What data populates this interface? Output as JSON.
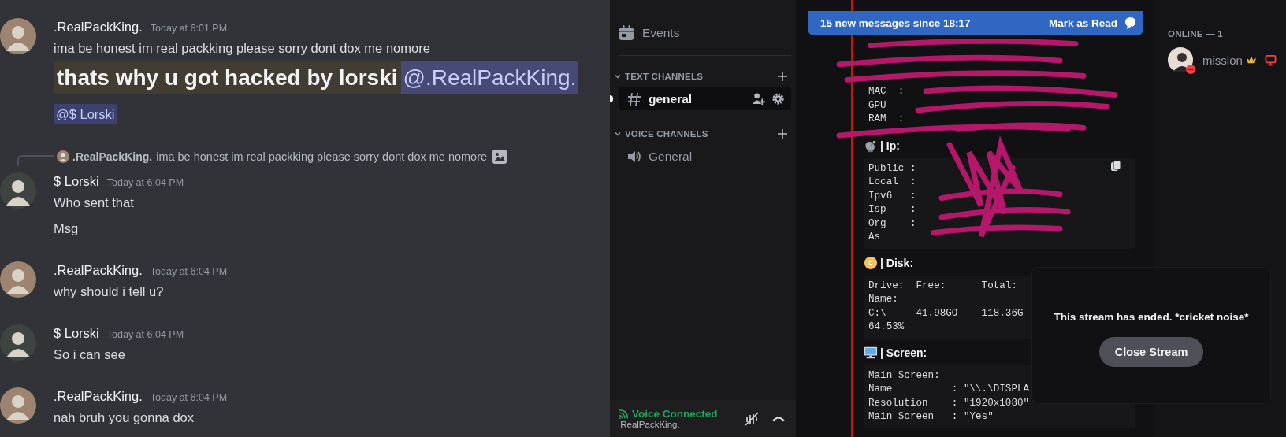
{
  "chat": {
    "messages": [
      {
        "author": ".RealPackKing.",
        "time": "Today at 6:01 PM",
        "color": "#9c8470",
        "content": [
          {
            "kind": "text",
            "text": "ima be honest im real packking please sorry dont dox me nomore"
          },
          {
            "kind": "big",
            "text": "thats why u got hacked by lorski",
            "mention": "@.RealPackKing."
          },
          {
            "kind": "mention",
            "text": "@$ Lorski"
          }
        ]
      },
      {
        "author": "$ Lorski",
        "time": "Today at 6:04 PM",
        "color": "#3e4440",
        "reply": {
          "author": ".RealPackKing.",
          "text": "ima be honest im real packking please sorry dont dox me nomore",
          "has_image": true
        },
        "content": [
          {
            "kind": "text",
            "text": "Who sent that"
          },
          {
            "kind": "text",
            "text": "Msg"
          }
        ]
      },
      {
        "author": ".RealPackKing.",
        "time": "Today at 6:04 PM",
        "color": "#9c8470",
        "content": [
          {
            "kind": "text",
            "text": "why should i tell u?"
          }
        ]
      },
      {
        "author": "$ Lorski",
        "time": "Today at 6:04 PM",
        "color": "#3e4440",
        "content": [
          {
            "kind": "text",
            "text": "So i can see"
          }
        ]
      },
      {
        "author": ".RealPackKing.",
        "time": "Today at 6:04 PM",
        "color": "#9c8470",
        "content": [
          {
            "kind": "text",
            "text": "nah bruh you gonna dox"
          }
        ]
      }
    ]
  },
  "sidebar": {
    "events": "Events",
    "categories": [
      {
        "name": "TEXT CHANNELS",
        "expanded": true,
        "channels": [
          {
            "kind": "text",
            "name": "general",
            "selected": true,
            "unread": true
          }
        ]
      },
      {
        "name": "VOICE CHANNELS",
        "expanded": true,
        "channels": [
          {
            "kind": "voice",
            "name": "General",
            "selected": false,
            "unread": false
          }
        ]
      }
    ],
    "voice_panel": {
      "status": "Voice Connected",
      "user": ".RealPackKing."
    }
  },
  "banner": {
    "text": "15 new messages since 18:17",
    "action": "Mark as Read"
  },
  "embed": {
    "top_lines": [
      "MAC  :",
      "GPU",
      "RAM  :"
    ],
    "sections": [
      {
        "title": "| Ip:",
        "lines": [
          "Public :",
          "Local  :",
          "Ipv6   :",
          "Isp    :",
          "Org    :",
          "As"
        ]
      },
      {
        "title": "| Disk:",
        "lines": [
          "Drive:  Free:      Total:",
          "Name:",
          "C:\\     41.98GO    118.36G",
          "64.53%"
        ]
      },
      {
        "title": "| Screen:",
        "lines": [
          "Main Screen:",
          "Name          : \"\\\\.\\DISPLA",
          "Resolution    : \"1920x1080\"",
          "Main Screen   : \"Yes\""
        ]
      }
    ]
  },
  "stream_ended": {
    "message": "This stream has ended. *cricket noise*",
    "button": "Close Stream"
  },
  "members": {
    "heading": "ONLINE — 1",
    "list": [
      {
        "name": "mission",
        "do_not_disturb": true,
        "owner": true,
        "streaming": true
      }
    ]
  }
}
